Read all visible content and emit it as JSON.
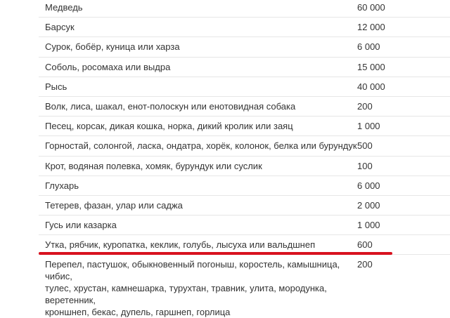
{
  "accent_color": "#d8121f",
  "rows": [
    {
      "name": "Медведь",
      "value": "60 000"
    },
    {
      "name": "Барсук",
      "value": "12 000"
    },
    {
      "name": "Сурок, бобёр, куница или харза",
      "value": "6 000"
    },
    {
      "name": "Соболь, росомаха или выдра",
      "value": "15 000"
    },
    {
      "name": "Рысь",
      "value": "40 000"
    },
    {
      "name": "Волк, лиса, шакал, енот-полоскун или енотовидная собака",
      "value": "200"
    },
    {
      "name": "Песец, корсак, дикая кошка, норка, дикий кролик или заяц",
      "value": "1 000"
    },
    {
      "name": "Горностай, солонгой, ласка, ондатра, хорёк, колонок, белка или бурундук",
      "value": "500"
    },
    {
      "name": "Крот, водяная полевка, хомяк, бурундук или суслик",
      "value": "100"
    },
    {
      "name": "Глухарь",
      "value": "6 000"
    },
    {
      "name": "Тетерев, фазан, улар или саджа",
      "value": "2 000"
    },
    {
      "name": "Гусь или казарка",
      "value": "1 000"
    },
    {
      "name": "Утка, рябчик, куропатка, кеклик, голубь, лысуха или вальдшнеп",
      "value": "600"
    }
  ],
  "last_row": {
    "lines": [
      "Перепел, пастушок, обыкновенный погоныш, коростель, камышница, чибис,",
      "тулес, хрустан, камнешарка, турухтан, травник, улита, мородунка, веретенник,",
      "кроншнеп, бекас, дупель, гаршнеп, горлица"
    ],
    "value": "200"
  }
}
